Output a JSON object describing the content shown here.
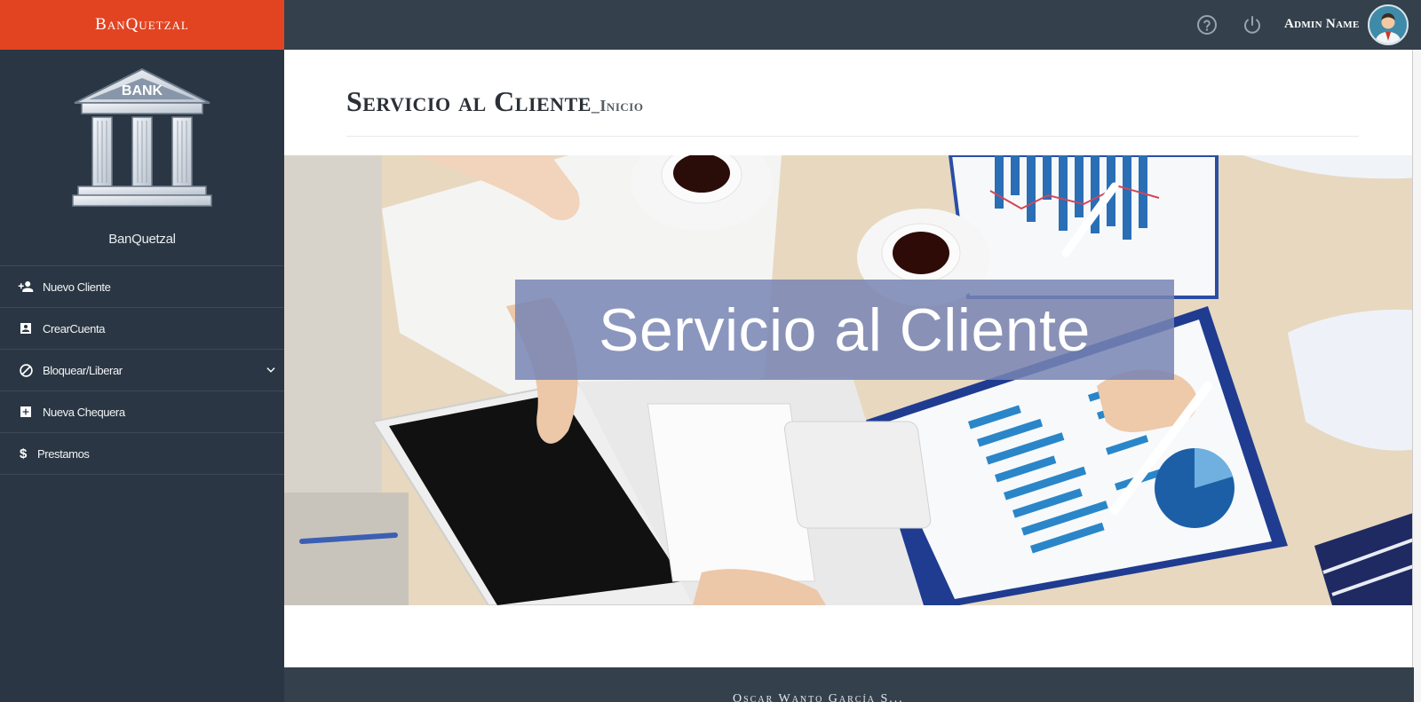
{
  "sidebar": {
    "brand": "BanQuetzal",
    "profile_name": "BanQuetzal",
    "logo_text": "BANK",
    "items": [
      {
        "label": "Nuevo Cliente",
        "icon": "person-add-icon"
      },
      {
        "label": "CrearCuenta",
        "icon": "contact-card-icon"
      },
      {
        "label": "Bloquear/Liberar",
        "icon": "block-icon"
      },
      {
        "label": "Nueva Chequera",
        "icon": "add-box-icon"
      },
      {
        "label": "Prestamos",
        "icon": "dollar-icon"
      }
    ]
  },
  "topbar": {
    "admin_name": "Admin Name",
    "help_icon": "help-icon",
    "power_icon": "power-icon"
  },
  "main": {
    "title": "Servicio al Cliente",
    "subtitle": "_Inicio",
    "hero_text": "Servicio al Cliente"
  },
  "footer": {
    "text": "Oscar Wanto García S..."
  },
  "colors": {
    "brand": "#e24422",
    "sidebar_bg": "#2a3643",
    "topbar_bg": "#34404c",
    "hero_banner": "#7885b4"
  }
}
